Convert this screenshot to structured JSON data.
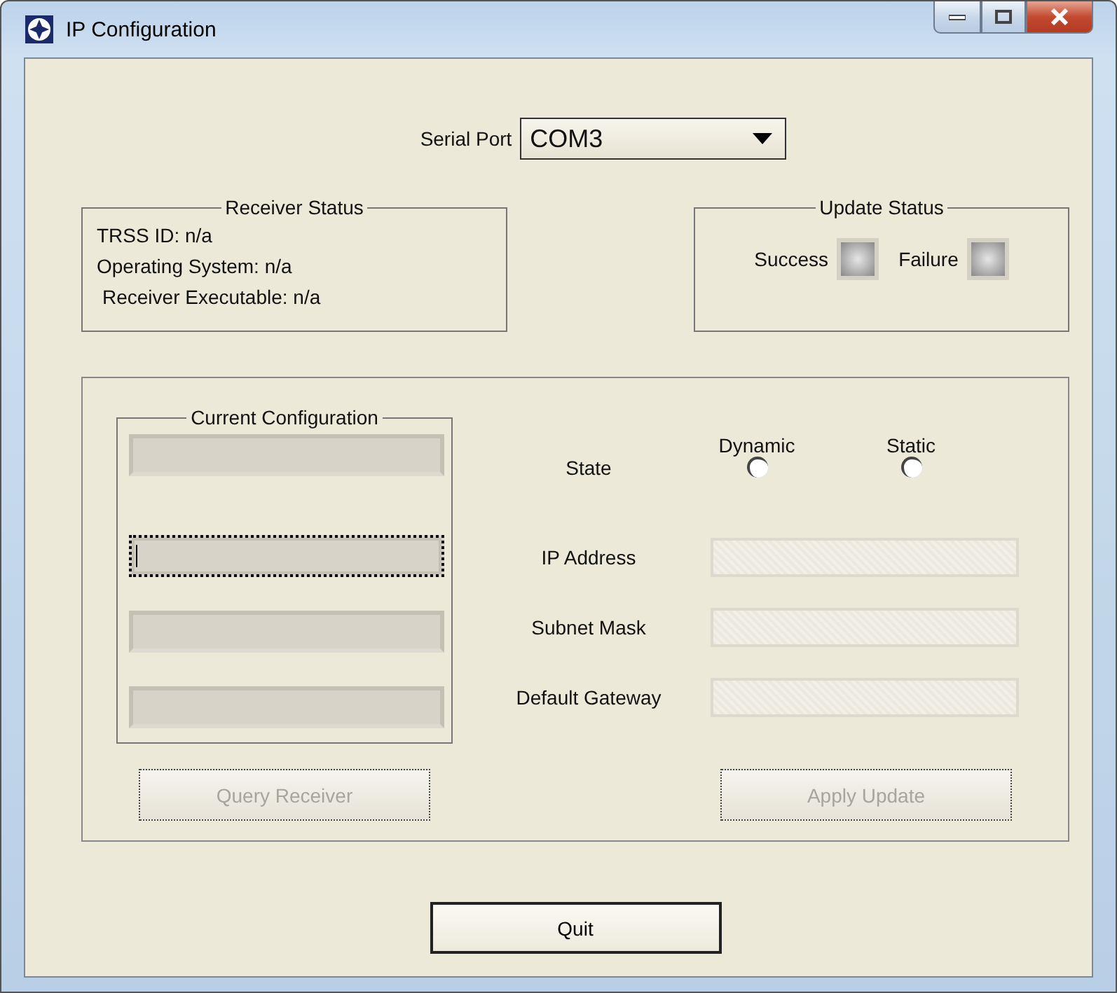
{
  "window": {
    "title": "IP Configuration"
  },
  "serial_port": {
    "label": "Serial Port",
    "value": "COM3"
  },
  "receiver_status": {
    "title": "Receiver Status",
    "lines": [
      "TRSS ID: n/a",
      "Operating System: n/a",
      "Receiver Executable: n/a"
    ]
  },
  "update_status": {
    "title": "Update Status",
    "indicators": [
      {
        "label": "Success",
        "on": false
      },
      {
        "label": "Failure",
        "on": false
      }
    ]
  },
  "current_configuration": {
    "title": "Current Configuration",
    "fields": [
      {
        "focused": false
      },
      {
        "focused": true
      },
      {
        "focused": false
      },
      {
        "focused": false
      }
    ]
  },
  "state": {
    "label": "State",
    "options": [
      {
        "label": "Dynamic",
        "selected": false
      },
      {
        "label": "Static",
        "selected": false
      }
    ]
  },
  "settings": [
    {
      "label": "IP Address",
      "disabled": true
    },
    {
      "label": "Subnet Mask",
      "disabled": true
    },
    {
      "label": "Default Gateway",
      "disabled": true
    }
  ],
  "buttons": [
    {
      "label": "Query Receiver",
      "disabled": true
    },
    {
      "label": "Apply Update",
      "disabled": true
    }
  ],
  "quit": {
    "label": "Quit"
  }
}
